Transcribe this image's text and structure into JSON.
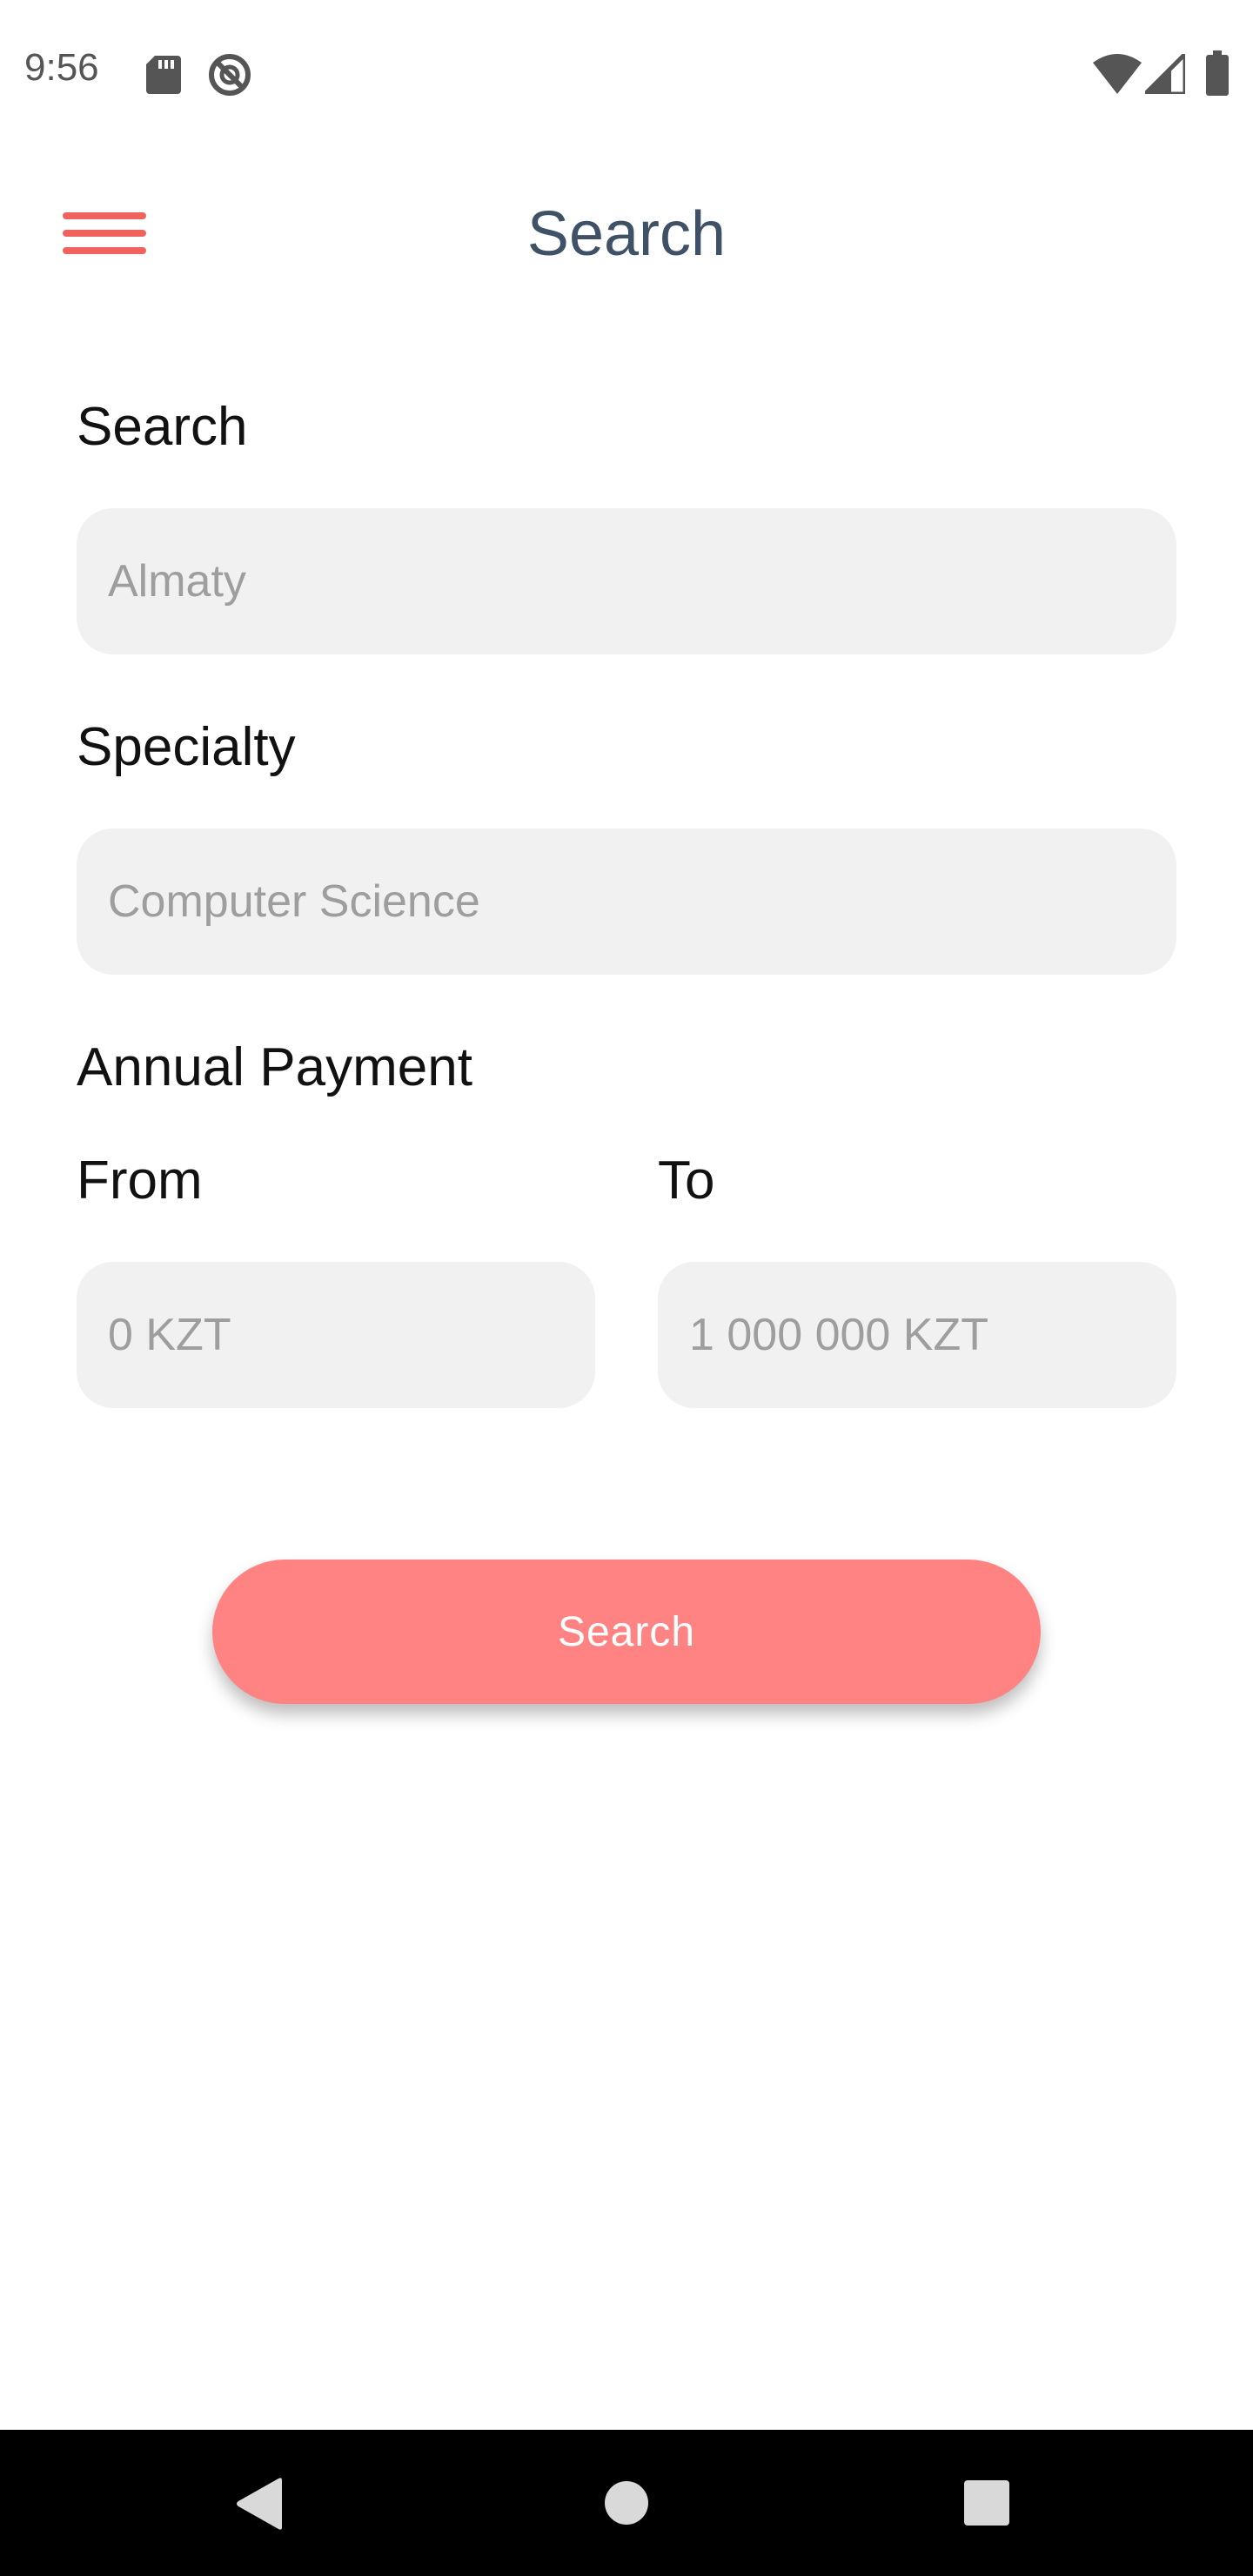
{
  "status_bar": {
    "time": "9:56",
    "icons": [
      "sd-card-icon",
      "no-sync-icon",
      "wifi-icon",
      "signal-icon",
      "battery-icon"
    ]
  },
  "app_bar": {
    "title": "Search",
    "menu_icon": "hamburger-menu-icon"
  },
  "form": {
    "search": {
      "label": "Search",
      "placeholder": "Almaty",
      "value": ""
    },
    "specialty": {
      "label": "Specialty",
      "placeholder": "Computer Science",
      "value": ""
    },
    "annual_payment": {
      "label": "Annual Payment",
      "from": {
        "label": "From",
        "placeholder": "0 KZT",
        "value": ""
      },
      "to": {
        "label": "To",
        "placeholder": "1 000 000 KZT",
        "value": ""
      }
    },
    "submit_label": "Search"
  },
  "nav_bar": {
    "icons": [
      "back-icon",
      "home-icon",
      "recents-icon"
    ]
  },
  "colors": {
    "accent": "#ff8383",
    "menu_icon": "#f0625e",
    "title": "#3f5166",
    "input_background": "#f1f1f1",
    "placeholder": "#9e9e9e",
    "nav_bar": "#000000"
  }
}
